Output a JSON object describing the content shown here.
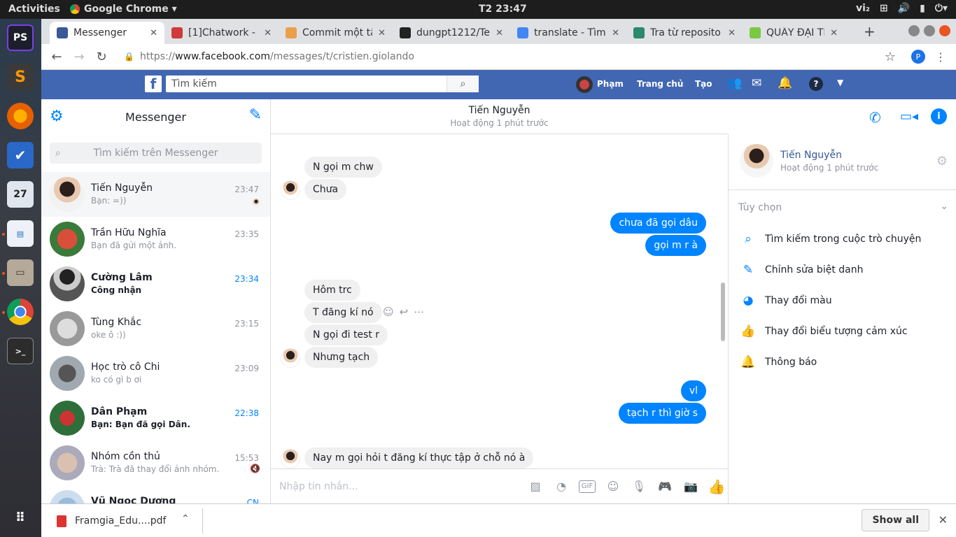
{
  "topbar": {
    "activities": "Activities",
    "app": "Google Chrome ▾",
    "clock": "T2 23:47",
    "ime": "vi₂"
  },
  "tabs": [
    {
      "label": "Messenger",
      "fav": "#3b5998"
    },
    {
      "label": "[1]Chatwork - [",
      "fav": "#d03a3a"
    },
    {
      "label": "Commit một tậ",
      "fav": "#e8a04a"
    },
    {
      "label": "dungpt1212/Te",
      "fav": "#222"
    },
    {
      "label": "translate - Tìm",
      "fav": "#4285f4"
    },
    {
      "label": "Tra từ reposito",
      "fav": "#2a8a6a"
    },
    {
      "label": "QUẨY ĐẠI TIỆ",
      "fav": "#7ac943"
    }
  ],
  "address": {
    "prefix": "https://",
    "domain": "www.facebook.com",
    "path": "/messages/t/cristien.giolando"
  },
  "profile_initial": "P",
  "fb": {
    "search_placeholder": "Tìm kiếm",
    "user": "Phạm",
    "home": "Trang chủ",
    "create": "Tạo"
  },
  "sidebar": {
    "title": "Messenger",
    "search_placeholder": "Tìm kiếm trên Messenger",
    "conversations": [
      {
        "name": "Tiến Nguyễn",
        "preview": "Bạn: =))",
        "time": "23:47",
        "unread": false,
        "selected": true
      },
      {
        "name": "Trần Hữu Nghĩa",
        "preview": "Bạn đã gửi một ảnh.",
        "time": "23:35",
        "unread": false
      },
      {
        "name": "Cường Lâm",
        "preview": "Công nhận",
        "time": "23:34",
        "unread": true
      },
      {
        "name": "Tùng Khắc",
        "preview": "oke ô :))",
        "time": "23:15",
        "unread": false
      },
      {
        "name": "Học trò cô Chi",
        "preview": "ko có gì b ơi",
        "time": "23:09",
        "unread": false
      },
      {
        "name": "Dân Phạm",
        "preview": "Bạn: Bạn đã gọi Dân.",
        "time": "22:38",
        "unread": true
      },
      {
        "name": "Nhóm cồn thủ",
        "preview": "Trà: Trà đã thay đổi ảnh nhóm.",
        "time": "15:53",
        "unread": false
      },
      {
        "name": "Vũ Ngọc Dương",
        "preview": "",
        "time": "CN",
        "unread": true
      }
    ]
  },
  "chat": {
    "name": "Tiến Nguyễn",
    "status": "Hoạt động 1 phút trước",
    "messages": [
      {
        "text": "N gọi m chw",
        "dir": "in"
      },
      {
        "text": "Chưa",
        "dir": "in"
      },
      {
        "text": "chưa đã gọi dâu",
        "dir": "out"
      },
      {
        "text": "gọi m r à",
        "dir": "out"
      },
      {
        "text": "Hôm trc",
        "dir": "in"
      },
      {
        "text": "T đăng kí nó",
        "dir": "in"
      },
      {
        "text": "N gọi đi test r",
        "dir": "in"
      },
      {
        "text": "Nhưng tạch",
        "dir": "in"
      },
      {
        "text": "vl",
        "dir": "out"
      },
      {
        "text": "tạch r thì giờ s",
        "dir": "out"
      },
      {
        "text": "Nay m gọi hỏi t đăng kí thực tập ở chỗ nó à",
        "dir": "in"
      }
    ],
    "compose_placeholder": "Nhập tin nhắn..."
  },
  "info": {
    "name": "Tiến Nguyễn",
    "status": "Hoạt động 1 phút trước",
    "options_title": "Tùy chọn",
    "options": [
      {
        "label": "Tìm kiếm trong cuộc trò chuyện",
        "icon": "search-icon"
      },
      {
        "label": "Chỉnh sửa biệt danh",
        "icon": "pencil-icon"
      },
      {
        "label": "Thay đổi màu",
        "icon": "palette-icon"
      },
      {
        "label": "Thay đổi biểu tượng cảm xúc",
        "icon": "thumbs-up-icon"
      },
      {
        "label": "Thông báo",
        "icon": "bell-icon"
      }
    ]
  },
  "download": {
    "file": "Framgia_Edu....pdf",
    "show_all": "Show all"
  },
  "colors": {
    "fb_blue": "#4267b2",
    "messenger_blue": "#0084ff"
  }
}
